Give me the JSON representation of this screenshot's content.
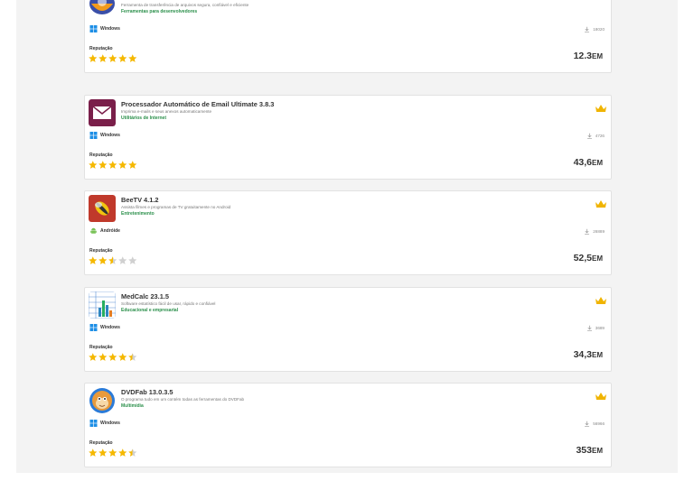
{
  "colors": {
    "category": "#2a8f4a",
    "star_filled": "#f5b800",
    "star_empty": "#d0d0d0",
    "crown": "#f0b400",
    "windows": "#1e8fe6",
    "android": "#78c257"
  },
  "apps": [
    {
      "title": "",
      "description": "Ferramenta de transferência de arquivos segura, confiável e eficiente",
      "category": "Ferramentas para desenvolvedores",
      "platform": "Windows",
      "platform_icon": "windows-icon",
      "downloads": "18020",
      "reputation_label": "Reputação",
      "rating": 5,
      "size_value": "12.3",
      "size_unit": "EM",
      "icon": "transfer-app-icon",
      "crown": false
    },
    {
      "title": "Processador Automático de Email Ultimate 3.8.3",
      "description": "Imprima e-mails e seus anexos automaticamente",
      "category": "Utilitários de Internet",
      "platform": "Windows",
      "platform_icon": "windows-icon",
      "downloads": "4726",
      "reputation_label": "Reputação",
      "rating": 5,
      "size_value": "43,6",
      "size_unit": "EM",
      "icon": "email-app-icon",
      "crown": true
    },
    {
      "title": "BeeTV 4.1.2",
      "description": "Assista filmes e programas de TV gratuitamente no Android",
      "category": "Entretenimento",
      "platform": "Andróide",
      "platform_icon": "android-icon",
      "downloads": "26889",
      "reputation_label": "Reputação",
      "rating": 2.5,
      "size_value": "52,5",
      "size_unit": "EM",
      "icon": "beetv-app-icon",
      "crown": true
    },
    {
      "title": "MedCalc 23.1.5",
      "description": "Software estatístico fácil de usar, rápido e confiável",
      "category": "Educacional e empresarial",
      "platform": "Windows",
      "platform_icon": "windows-icon",
      "downloads": "3689",
      "reputation_label": "Reputação",
      "rating": 4.5,
      "size_value": "34,3",
      "size_unit": "EM",
      "icon": "medcalc-app-icon",
      "crown": true
    },
    {
      "title": "DVDFab 13.0.3.5",
      "description": "O programa tudo em um contém todas as ferramentas do DVDFab",
      "category": "Multimídia",
      "platform": "Windows",
      "platform_icon": "windows-icon",
      "downloads": "56966",
      "reputation_label": "Reputação",
      "rating": 4.5,
      "size_value": "353",
      "size_unit": "EM",
      "icon": "dvdfab-app-icon",
      "crown": true
    }
  ]
}
